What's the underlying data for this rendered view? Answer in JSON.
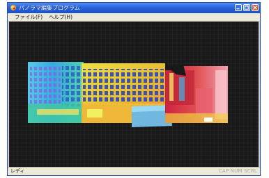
{
  "window": {
    "title": "パノラマ編集プログラム"
  },
  "menu": {
    "file": "ファイル(F)",
    "help": "ヘルプ(H)"
  },
  "status": {
    "left": "レディ",
    "right": "CAP NUM SCRL"
  },
  "image": {
    "description_icon": "thermal-panorama-image"
  },
  "colors": {
    "titlebar": "#2a64dc",
    "close_button": "#d8512a",
    "canvas_bg": "#191919"
  }
}
